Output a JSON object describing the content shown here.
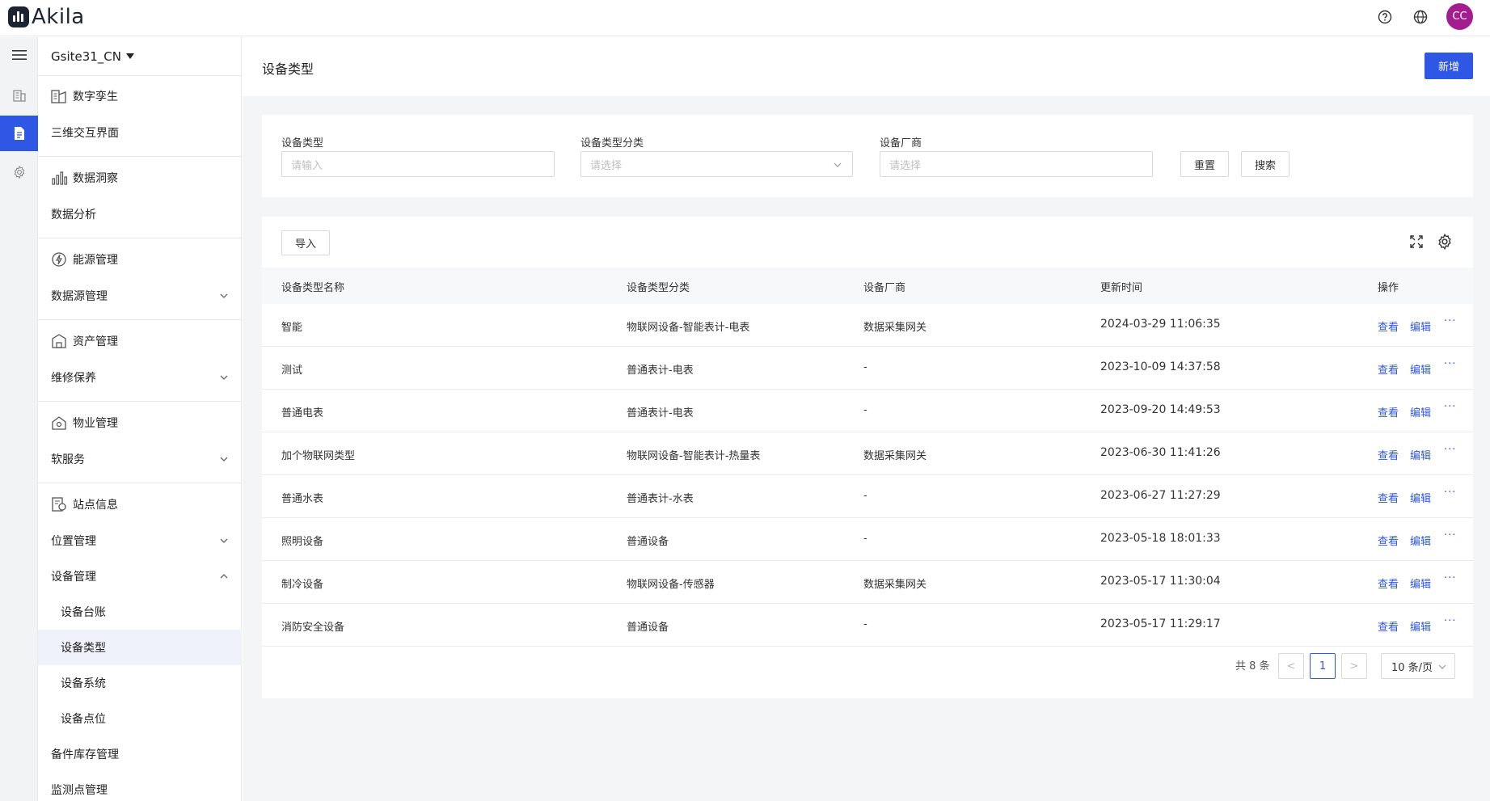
{
  "header": {
    "brand": "Akila",
    "avatar_initials": "CC",
    "avatar_color": "#a41d8f"
  },
  "accent_color": "#2f57e6",
  "sidebar": {
    "site": "Gsite31_CN",
    "groups": [
      {
        "title": "数字孪生",
        "items": [
          {
            "label": "三维交互界面"
          }
        ]
      },
      {
        "title": "数据洞察",
        "items": [
          {
            "label": "数据分析"
          }
        ]
      },
      {
        "title": "能源管理",
        "items": [
          {
            "label": "数据源管理"
          }
        ]
      },
      {
        "title": "资产管理",
        "items": [
          {
            "label": "维修保养"
          }
        ]
      },
      {
        "title": "物业管理",
        "items": [
          {
            "label": "软服务"
          }
        ]
      },
      {
        "title": "站点信息",
        "items": [
          {
            "label": "位置管理"
          },
          {
            "label": "设备管理"
          },
          {
            "label": "备件库存管理"
          },
          {
            "label": "监测点管理"
          }
        ]
      }
    ],
    "device_sub": [
      "设备台账",
      "设备类型",
      "设备系统",
      "设备点位"
    ]
  },
  "page": {
    "title": "设备类型",
    "add_label": "新增"
  },
  "filter": {
    "type_label": "设备类型",
    "type_placeholder": "请输入",
    "category_label": "设备类型分类",
    "category_placeholder": "请选择",
    "vendor_label": "设备厂商",
    "vendor_placeholder": "请选择",
    "reset_label": "重置",
    "search_label": "搜索"
  },
  "table": {
    "import_label": "导入",
    "columns": [
      "设备类型名称",
      "设备类型分类",
      "设备厂商",
      "更新时间",
      "操作"
    ],
    "view_label": "查看",
    "edit_label": "编辑",
    "more_label": "···",
    "rows": [
      {
        "name": "智能",
        "category": "物联网设备-智能表计-电表",
        "vendor": "数据采集网关",
        "updated": "2024-03-29 11:06:35"
      },
      {
        "name": "测试",
        "category": "普通表计-电表",
        "vendor": "-",
        "updated": "2023-10-09 14:37:58"
      },
      {
        "name": "普通电表",
        "category": "普通表计-电表",
        "vendor": "-",
        "updated": "2023-09-20 14:49:53"
      },
      {
        "name": "加个物联网类型",
        "category": "物联网设备-智能表计-热量表",
        "vendor": "数据采集网关",
        "updated": "2023-06-30 11:41:26"
      },
      {
        "name": "普通水表",
        "category": "普通表计-水表",
        "vendor": "-",
        "updated": "2023-06-27 11:27:29"
      },
      {
        "name": "照明设备",
        "category": "普通设备",
        "vendor": "-",
        "updated": "2023-05-18 18:01:33"
      },
      {
        "name": "制冷设备",
        "category": "物联网设备-传感器",
        "vendor": "数据采集网关",
        "updated": "2023-05-17 11:30:04"
      },
      {
        "name": "消防安全设备",
        "category": "普通设备",
        "vendor": "-",
        "updated": "2023-05-17 11:29:17"
      }
    ]
  },
  "pagination": {
    "total": "共 8 条",
    "current": "1",
    "prev": "<",
    "next": ">",
    "page_size": "10 条/页"
  }
}
